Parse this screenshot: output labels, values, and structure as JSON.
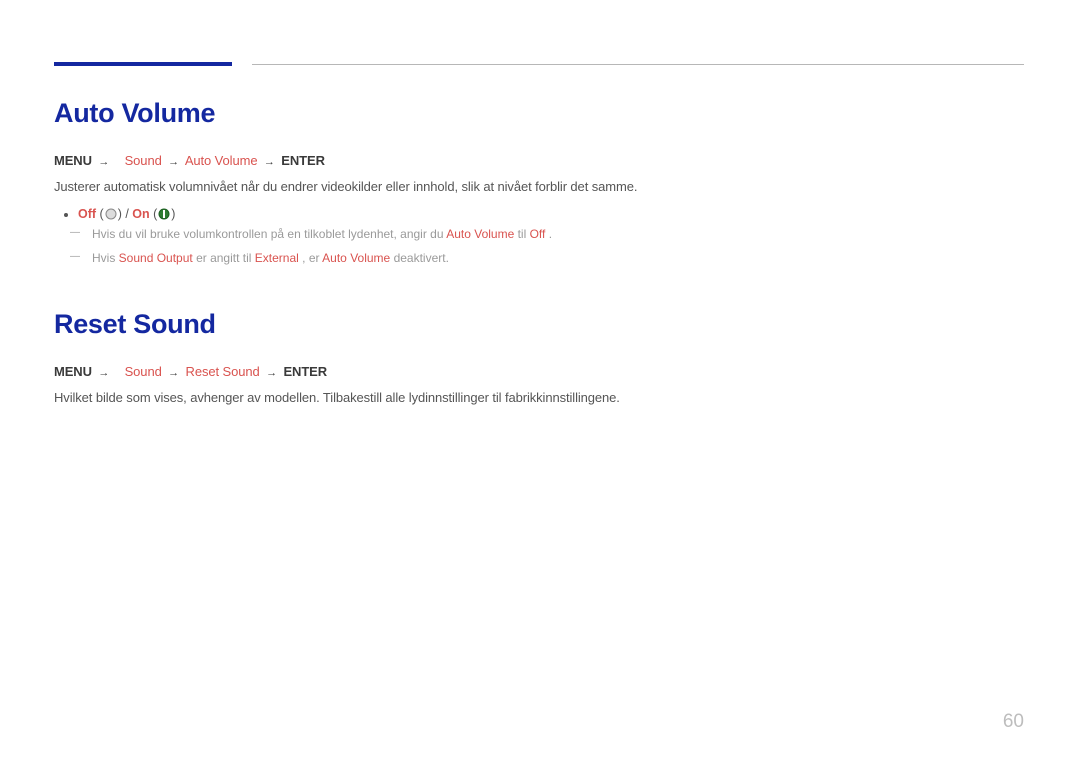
{
  "page_number": "60",
  "section1": {
    "title": "Auto Volume",
    "crumb": {
      "menu": "MENU",
      "p1": "Sound",
      "p2": "Auto Volume",
      "enter": "ENTER"
    },
    "lead": "Justerer automatisk volumnivået når du endrer videokilder eller innhold, slik at nivået forblir det samme.",
    "opts": {
      "off": "Off",
      "on": "On"
    },
    "note1": {
      "a": "Hvis du vil bruke volumkontrollen på en tilkoblet lydenhet, angir du ",
      "b": "Auto Volume",
      "c": " til ",
      "d": "Off",
      "e": "."
    },
    "note2": {
      "a": "Hvis ",
      "b": "Sound Output",
      "c": " er angitt til ",
      "d": "External",
      "e": ", er ",
      "f": "Auto Volume",
      "g": " deaktivert."
    }
  },
  "section2": {
    "title": "Reset Sound",
    "crumb": {
      "menu": "MENU",
      "p1": "Sound",
      "p2": "Reset Sound",
      "enter": "ENTER"
    },
    "lead": "Hvilket bilde som vises, avhenger av modellen. Tilbakestill alle lydinnstillinger til fabrikkinnstillingene."
  }
}
